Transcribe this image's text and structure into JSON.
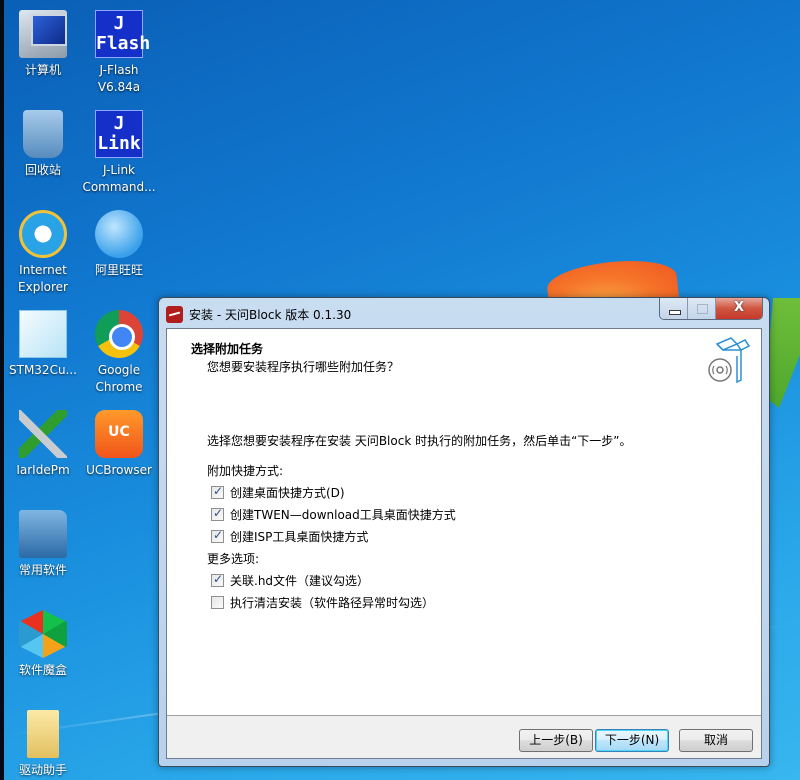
{
  "desktop": {
    "icons": [
      {
        "label": "计算机",
        "icon": "computer-icon"
      },
      {
        "label": "J-Flash\nV6.84a",
        "icon": "jflash-icon",
        "glyph": "J\nFlash"
      },
      {
        "label": "回收站",
        "icon": "recycle-bin-icon"
      },
      {
        "label": "J-Link\nCommand...",
        "icon": "jlink-icon",
        "glyph": "J\nLink"
      },
      {
        "label": "Internet\nExplorer",
        "icon": "internet-explorer-icon"
      },
      {
        "label": "阿里旺旺",
        "icon": "aliwangwang-icon"
      },
      {
        "label": "STM32Cu...",
        "icon": "stm32cube-icon"
      },
      {
        "label": "Google\nChrome",
        "icon": "chrome-icon"
      },
      {
        "label": "IarIdePm",
        "icon": "iar-ide-icon"
      },
      {
        "label": "UCBrowser",
        "icon": "ucbrowser-icon"
      },
      {
        "label": "常用软件",
        "icon": "folder-icon"
      },
      {
        "label": "软件魔盒",
        "icon": "software-box-icon"
      },
      {
        "label": "驱动助手",
        "icon": "folder-icon"
      }
    ]
  },
  "dialog": {
    "title": "安装 - 天问Block 版本 0.1.30",
    "caption_buttons": {
      "minimize": "minimize",
      "maximize": "maximize",
      "close": "X"
    },
    "header": {
      "title": "选择附加任务",
      "subtitle": "您想要安装程序执行哪些附加任务？",
      "icon": "install-box-disc-icon"
    },
    "description": "选择您想要安装程序在安装 天问Block 时执行的附加任务，然后单击“下一步”。",
    "groups": [
      {
        "label": "附加快捷方式:",
        "options": [
          {
            "label": "创建桌面快捷方式(D)",
            "checked": true
          },
          {
            "label": "创建TWEN—download工具桌面快捷方式",
            "checked": true
          },
          {
            "label": "创建ISP工具桌面快捷方式",
            "checked": true
          }
        ]
      },
      {
        "label": "更多选项:",
        "options": [
          {
            "label": "关联.hd文件（建议勾选）",
            "checked": true
          },
          {
            "label": "执行清洁安装（软件路径异常时勾选）",
            "checked": false
          }
        ]
      }
    ],
    "buttons": {
      "back": "上一步(B)",
      "next": "下一步(N)",
      "cancel": "取消"
    }
  }
}
